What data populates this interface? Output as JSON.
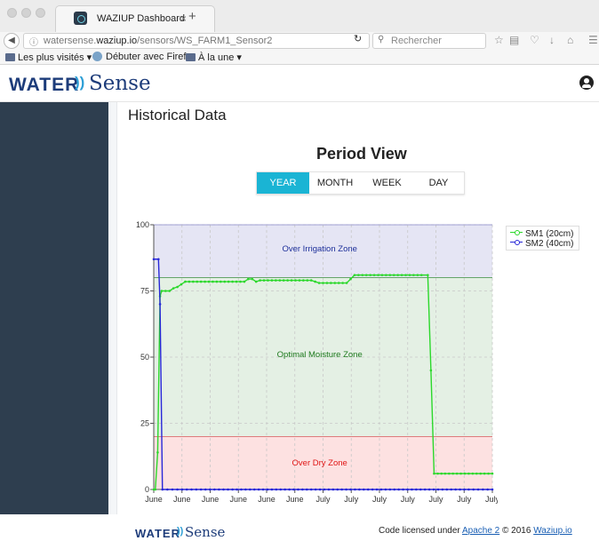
{
  "browser": {
    "tab_title": "WAZIUP Dashboard",
    "close_glyph": "×",
    "new_tab_glyph": "+",
    "url_prefix": "watersense.",
    "url_domain": "waziup.io",
    "url_path": "/sensors/WS_FARM1_Sensor2",
    "search_placeholder": "Rechercher",
    "bookmarks": [
      "Les plus visités",
      "Débuter avec Firef…",
      "À la une"
    ]
  },
  "header": {
    "logo_water": "WATER",
    "logo_sense": "Sense"
  },
  "page": {
    "title": "Historical Data",
    "period_title": "Period View",
    "period_buttons": [
      "YEAR",
      "MONTH",
      "WEEK",
      "DAY"
    ],
    "active_period": "YEAR"
  },
  "footer": {
    "logo_water": "WATER",
    "logo_sense": "Sense",
    "text_before": "Code licensed under ",
    "apache_link": "Apache 2",
    "text_mid": " © 2016 ",
    "waziup_link": "Waziup.io"
  },
  "colors": {
    "accent": "#1ab4d4",
    "sidebar": "#2e3e4f",
    "sm1": "#2bd82b",
    "sm2": "#2727d8",
    "zone_over_irrigation": "#e5e5f4",
    "zone_optimal": "#e4f0e4",
    "zone_dry": "#fde1e1"
  },
  "chart_data": {
    "type": "line",
    "ylim": [
      0,
      100
    ],
    "y_ticks": [
      0,
      25,
      50,
      75,
      100
    ],
    "x_tick_labels": [
      "June",
      "June",
      "June",
      "June",
      "June",
      "June",
      "July",
      "July",
      "July",
      "July",
      "July",
      "July",
      "July"
    ],
    "zones": [
      {
        "label": "Over Irrigation Zone",
        "from": 80,
        "to": 100,
        "color": "#e5e5f4",
        "text_color": "#1d2f9a"
      },
      {
        "label": "Optimal Moisture Zone",
        "from": 20,
        "to": 80,
        "color": "#e4f0e4",
        "text_color": "#1e7a1e"
      },
      {
        "label": "Over Dry Zone",
        "from": 0,
        "to": 20,
        "color": "#fde1e1",
        "text_color": "#e01515"
      }
    ],
    "legend_position": "top-right",
    "series": [
      {
        "name": "SM1 (20cm)",
        "color": "#2bd82b",
        "points": [
          [
            0.0,
            0
          ],
          [
            0.2,
            0
          ],
          [
            0.5,
            14
          ],
          [
            0.8,
            73
          ],
          [
            1.0,
            75
          ],
          [
            1.5,
            75
          ],
          [
            2.0,
            75
          ],
          [
            2.5,
            76
          ],
          [
            3.0,
            76.5
          ],
          [
            3.5,
            77.5
          ],
          [
            4.0,
            78.5
          ],
          [
            6.0,
            78.5
          ],
          [
            8.0,
            78.5
          ],
          [
            10.0,
            78.5
          ],
          [
            11.5,
            78.5
          ],
          [
            12.0,
            79.5
          ],
          [
            12.5,
            79.5
          ],
          [
            13.0,
            78.5
          ],
          [
            13.5,
            79
          ],
          [
            15.0,
            79
          ],
          [
            17.0,
            79
          ],
          [
            19.0,
            79
          ],
          [
            20.0,
            79
          ],
          [
            21.0,
            78
          ],
          [
            23.0,
            78
          ],
          [
            24.5,
            78
          ],
          [
            25.5,
            81
          ],
          [
            27.0,
            81
          ],
          [
            29.0,
            81
          ],
          [
            31.0,
            81
          ],
          [
            33.0,
            81
          ],
          [
            34.0,
            81
          ],
          [
            34.8,
            81
          ],
          [
            35.2,
            45
          ],
          [
            35.6,
            6
          ],
          [
            37.0,
            6
          ],
          [
            39.0,
            6
          ],
          [
            41.0,
            6
          ],
          [
            43.0,
            6
          ]
        ]
      },
      {
        "name": "SM2 (40cm)",
        "color": "#2727d8",
        "points": [
          [
            0.0,
            87
          ],
          [
            0.6,
            87
          ],
          [
            0.8,
            70
          ],
          [
            1.1,
            0
          ],
          [
            3.0,
            0
          ],
          [
            6.0,
            0
          ],
          [
            10.0,
            0
          ],
          [
            15.0,
            0
          ],
          [
            20.0,
            0
          ],
          [
            25.0,
            0
          ],
          [
            30.0,
            0
          ],
          [
            35.0,
            0
          ],
          [
            40.0,
            0
          ],
          [
            43.0,
            0
          ]
        ]
      }
    ]
  }
}
